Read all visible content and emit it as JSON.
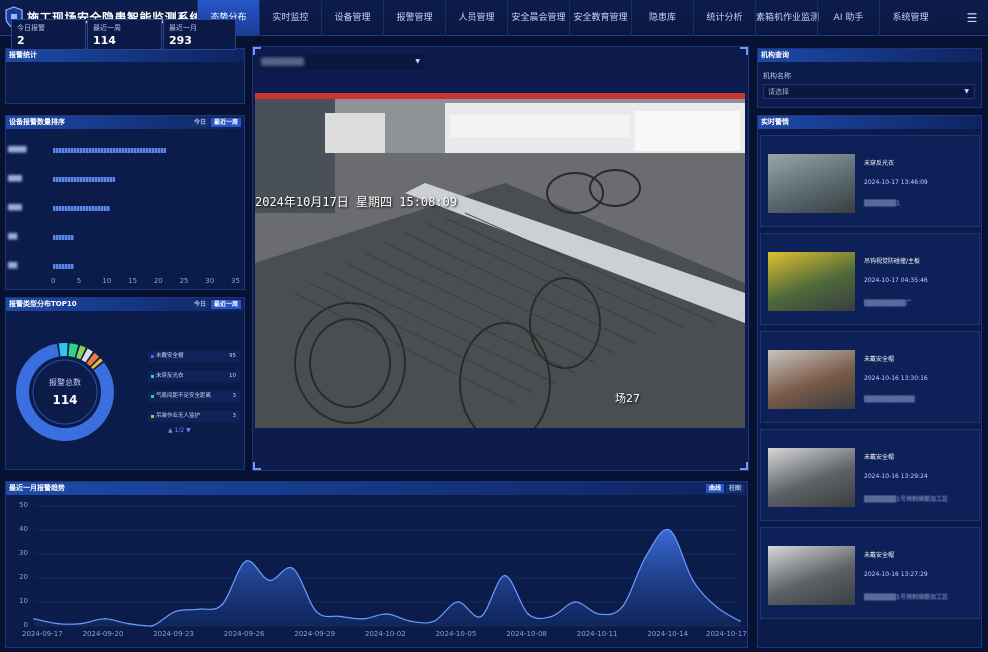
{
  "header": {
    "title": "施工现场安全隐患智能监测系统",
    "nav": [
      {
        "label": "态势分布",
        "active": true,
        "w": 62
      },
      {
        "label": "实时监控",
        "active": false,
        "w": 62
      },
      {
        "label": "设备管理",
        "active": false,
        "w": 62
      },
      {
        "label": "报警管理",
        "active": false,
        "w": 62
      },
      {
        "label": "人员管理",
        "active": false,
        "w": 62
      },
      {
        "label": "安全晨会管理",
        "active": false,
        "w": 62
      },
      {
        "label": "安全教育管理",
        "active": false,
        "w": 62
      },
      {
        "label": "隐患库",
        "active": false,
        "w": 62
      },
      {
        "label": "统计分析",
        "active": false,
        "w": 62
      },
      {
        "label": "素箱机作业监测",
        "active": false,
        "w": 62
      },
      {
        "label": "AI 助手",
        "active": false,
        "w": 62
      },
      {
        "label": "系统管理",
        "active": false,
        "w": 62
      }
    ],
    "menu_icon": "☰"
  },
  "alarm_stats": {
    "title": "报警统计",
    "items": [
      {
        "label": "今日报警",
        "value": "2"
      },
      {
        "label": "最近一周",
        "value": "114"
      },
      {
        "label": "最近一月",
        "value": "293"
      }
    ]
  },
  "device_rank": {
    "title": "设备报警数量排序",
    "tabs": [
      "今日",
      "最近一周"
    ],
    "active_tab": 1,
    "rows": [
      {
        "label": "████",
        "value": 22
      },
      {
        "label": "███",
        "value": 12
      },
      {
        "label": "███",
        "value": 11
      },
      {
        "label": "██",
        "value": 4
      },
      {
        "label": "██",
        "value": 4
      }
    ],
    "x_ticks": [
      "0",
      "5",
      "10",
      "15",
      "20",
      "25",
      "30",
      "35"
    ],
    "x_max": 35
  },
  "type_top10": {
    "title": "报警类型分布TOP10",
    "tabs": [
      "今日",
      "最近一周"
    ],
    "active_tab": 1,
    "center_label": "报警总数",
    "total": "114",
    "legend": [
      {
        "name": "未戴安全帽",
        "value": "95",
        "color": "#3b6fe0"
      },
      {
        "name": "未穿反光衣",
        "value": "10",
        "color": "#32c5e8"
      },
      {
        "name": "气瓶间距不足安全距离",
        "value": "3",
        "color": "#2fd488"
      },
      {
        "name": "吊装作业无人监护",
        "value": "3",
        "color": "#8fd14f"
      }
    ],
    "slices": [
      {
        "value": 95,
        "color": "#3b6fe0"
      },
      {
        "value": 4,
        "color": "#32c5e8"
      },
      {
        "value": 4,
        "color": "#2fd488"
      },
      {
        "value": 3,
        "color": "#8fd14f"
      },
      {
        "value": 3,
        "color": "#d8dde8"
      },
      {
        "value": 3,
        "color": "#f07a3a"
      },
      {
        "value": 2,
        "color": "#e8bd35"
      }
    ],
    "pager": "▲ 1/2 ▼"
  },
  "video": {
    "channel": "▒▒▒▒▒▒▒▒",
    "overlay_time": "2024年10月17日 星期四 15:08:09",
    "camera_name": "场27"
  },
  "org_query": {
    "title": "机构查询",
    "field_label": "机构名称",
    "placeholder": "请选择"
  },
  "realtime_alarms": {
    "title": "实时警情",
    "items": [
      {
        "type": "未穿反光衣",
        "time": "2024-10-17 13:46:09",
        "loc": "▒▒▒▒▒▒▒1"
      },
      {
        "type": "吊钩视觉防碰撞/主板",
        "time": "2024-10-17 04:35:46",
        "loc": "▒▒▒▒▒▒▒▒▒厂"
      },
      {
        "type": "未戴安全帽",
        "time": "2024-10-16 13:30:16",
        "loc": "▒▒▒▒▒▒▒▒▒▒▒"
      },
      {
        "type": "未戴安全帽",
        "time": "2024-10-16 13:29:24",
        "loc": "▒▒▒▒▒▒▒1号预制钢筋加工区"
      },
      {
        "type": "未戴安全帽",
        "time": "2024-10-16 13:27:29",
        "loc": "▒▒▒▒▒▒▒1号预制钢筋加工区"
      }
    ]
  },
  "trend": {
    "title": "最近一月报警趋势",
    "tabs": [
      "曲线",
      "柱图"
    ],
    "active_tab": 0
  },
  "chart_data": {
    "type": "area",
    "title": "最近一月报警趋势",
    "x": [
      "2024-09-17",
      "2024-09-18",
      "2024-09-19",
      "2024-09-20",
      "2024-09-21",
      "2024-09-22",
      "2024-09-23",
      "2024-09-24",
      "2024-09-25",
      "2024-09-26",
      "2024-09-27",
      "2024-09-28",
      "2024-09-29",
      "2024-09-30",
      "2024-10-01",
      "2024-10-02",
      "2024-10-03",
      "2024-10-04",
      "2024-10-05",
      "2024-10-06",
      "2024-10-07",
      "2024-10-08",
      "2024-10-09",
      "2024-10-10",
      "2024-10-11",
      "2024-10-12",
      "2024-10-13",
      "2024-10-14",
      "2024-10-15",
      "2024-10-16",
      "2024-10-17"
    ],
    "values": [
      3,
      1,
      1,
      3,
      1,
      0,
      6,
      7,
      9,
      27,
      19,
      24,
      6,
      4,
      3,
      5,
      2,
      2,
      10,
      4,
      21,
      5,
      4,
      10,
      5,
      8,
      29,
      40,
      19,
      8,
      2
    ],
    "x_tick_labels": [
      "2024-09-17",
      "2024-09-20",
      "2024-09-23",
      "2024-09-26",
      "2024-09-29",
      "2024-10-02",
      "2024-10-05",
      "2024-10-08",
      "2024-10-11",
      "2024-10-14",
      "2024-10-17"
    ],
    "y_ticks": [
      0,
      10,
      20,
      30,
      40,
      50
    ],
    "ylim": [
      0,
      50
    ],
    "grid": true
  }
}
